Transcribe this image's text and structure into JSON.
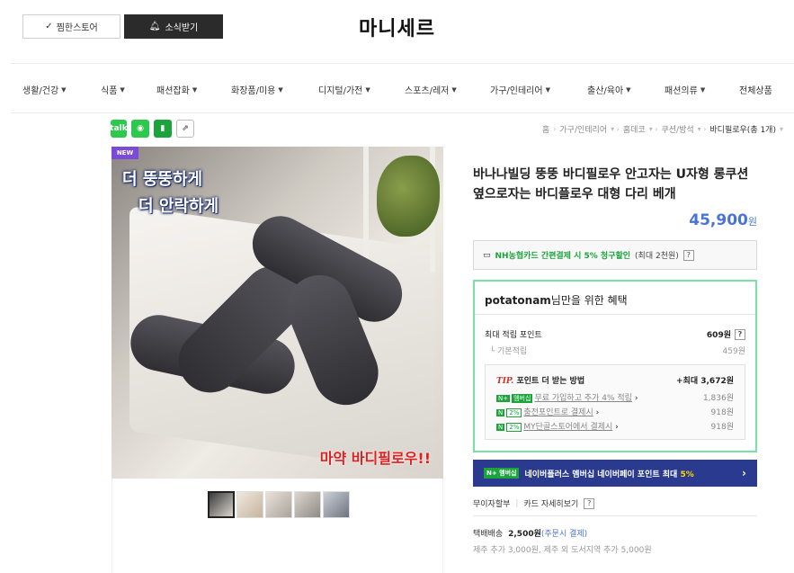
{
  "header": {
    "favorite_label": "찜한스토어",
    "notify_label": "소식받기",
    "store_name": "마니세르"
  },
  "categories": [
    "생활/건강",
    "식품",
    "패션잡화",
    "화장품/미용",
    "디지털/가전",
    "스포츠/레저",
    "가구/인테리어",
    "출산/육아",
    "패션의류",
    "전체상품"
  ],
  "breadcrumb": [
    "홈",
    "가구/인테리어",
    "홈데코",
    "쿠션/방석",
    "바디필로우(총 1개)"
  ],
  "image": {
    "badge": "NEW",
    "ad_line1": "더 뚱뚱하게",
    "ad_line2": "더 안락하게",
    "ad_line3": "마약 바디필로우!!"
  },
  "product": {
    "title": "바나나빌딩 뚱뚱 바디필로우 안고자는 U자형 롱쿠션 옆으로자는 바디플로우 대형 다리 베개",
    "price": "45,900",
    "price_unit": "원"
  },
  "nh": {
    "text": "NH농협카드 간편결제 시 5% 청구할인",
    "limit": "(최대 2천원)"
  },
  "benefit": {
    "user": "potatonam",
    "title_suffix": "님만을 위한 혜택",
    "max_point_label": "최대 적립 포인트",
    "max_point_value": "609원",
    "base_label": "기본적립",
    "base_value": "459원",
    "tip_title_prefix": "TIP.",
    "tip_title": "포인트 더 받는 방법",
    "tip_total": "+최대 3,672원",
    "tip_rows": [
      {
        "tag": "멤버십",
        "text": "무료 가입하고 추가 4% 적립",
        "value": "1,836원"
      },
      {
        "tag": "2%",
        "text": "충전포인트로 결제시",
        "value": "918원"
      },
      {
        "tag": "2%",
        "text": "MY단골스토어에서 결제시",
        "value": "918원"
      }
    ]
  },
  "npay": {
    "text_a": "네이버플러스 멤버십 네이버페이 포인트 최대",
    "highlight": "5%",
    "badge": "N+ 멤버십"
  },
  "payment": {
    "option1": "무이자할부",
    "option2": "카드 자세히보기"
  },
  "shipping": {
    "label": "택배배송",
    "fee": "2,500원",
    "fee_note": "(주문시 결제)",
    "extra": "제주 추가 3,000원, 제주 외 도서지역 추가 5,000원"
  },
  "colors": {
    "price": "#4a74d6",
    "npay_bg": "#2a3a8f",
    "benefit_border": "#7be0a6",
    "naver_green": "#1aa43b"
  }
}
